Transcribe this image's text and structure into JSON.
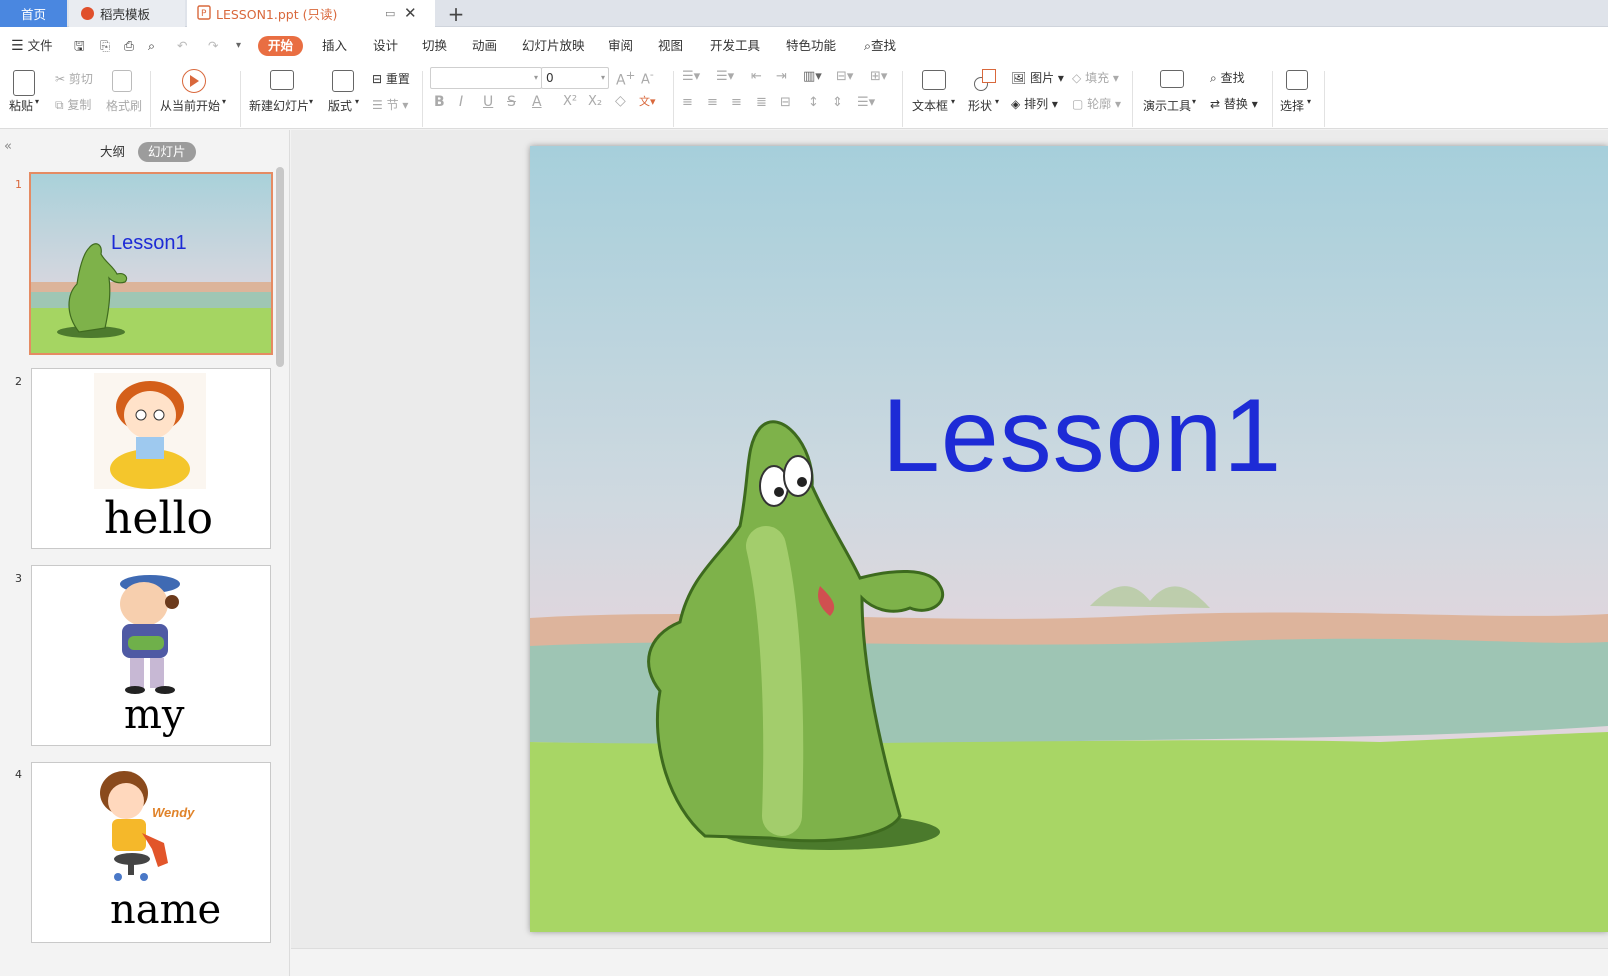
{
  "tabs": {
    "home": "首页",
    "template": "稻壳模板",
    "document": "LESSON1.ppt (只读)"
  },
  "menu": {
    "file": "文件",
    "start": "开始",
    "insert": "插入",
    "design": "设计",
    "transition": "切换",
    "animation": "动画",
    "slideshow": "幻灯片放映",
    "review": "审阅",
    "view": "视图",
    "devtools": "开发工具",
    "special": "特色功能",
    "search": "查找"
  },
  "ribbon": {
    "paste": "粘贴",
    "cut": "剪切",
    "copy": "复制",
    "format_painter": "格式刷",
    "from_current": "从当前开始",
    "new_slide": "新建幻灯片",
    "layout": "版式",
    "reset": "重置",
    "section": "节",
    "font_size": "0",
    "textbox": "文本框",
    "shape": "形状",
    "picture": "图片",
    "fill": "填充",
    "arrange": "排列",
    "outline": "轮廓",
    "present_tool": "演示工具",
    "find": "查找",
    "replace": "替换",
    "select": "选择"
  },
  "panel": {
    "outline_tab": "大纲",
    "slides_tab": "幻灯片",
    "slides": [
      {
        "num": "1",
        "title": "Lesson1"
      },
      {
        "num": "2",
        "word": "hello"
      },
      {
        "num": "3",
        "word": "my"
      },
      {
        "num": "4",
        "word": "name",
        "label": "Wendy"
      }
    ]
  },
  "slide": {
    "title": "Lesson1"
  },
  "colors": {
    "accent": "#e96e42",
    "home_tab": "#4a87e0",
    "title_blue": "#1d2bd6"
  }
}
